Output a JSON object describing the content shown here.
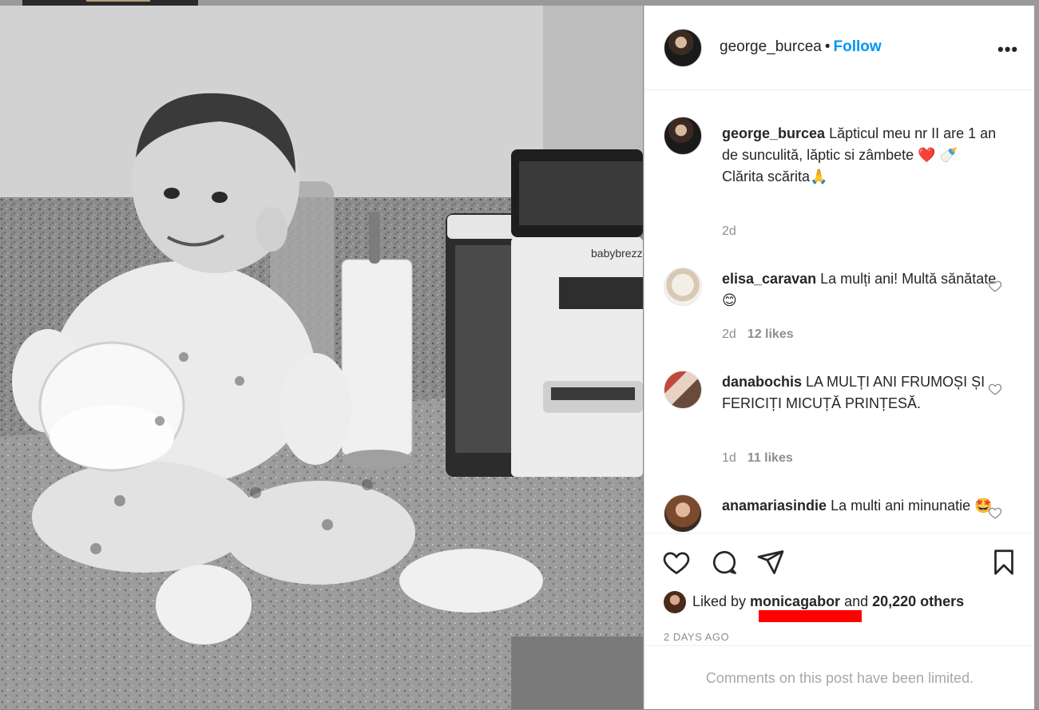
{
  "post": {
    "username": "george_burcea",
    "separator": "•",
    "follow_label": "Follow",
    "more_label": "•••"
  },
  "caption": {
    "username": "george_burcea",
    "line1": " Lăpticul meu nr II are 1 an de sunculită, lăptic si zâmbete ❤️ 🍼",
    "line2": "Clărita scărita🙏",
    "time": "2d"
  },
  "comments": [
    {
      "username": "elisa_caravan",
      "text": " La mulți ani! Multă sănătate😊",
      "time": "2d",
      "likes": "12 likes"
    },
    {
      "username": "danabochis",
      "text": " LA MULȚI ANI FRUMOȘI ȘI FERICIȚI MICUȚĂ PRINȚESĂ.",
      "time": "1d",
      "likes": "11 likes"
    },
    {
      "username": "anamariasindie",
      "text": " La multi ani minunatie 🤩",
      "time": "",
      "likes": ""
    }
  ],
  "likes": {
    "prefix": "Liked by ",
    "user": "monicagabor",
    "middle": " and ",
    "others": "20,220 others"
  },
  "timestamp": "2 DAYS AGO",
  "limited_notice": "Comments on this post have been limited.",
  "photo": {
    "brand_text": "babybrezza"
  },
  "colors": {
    "accent": "#0095f6",
    "redaction": "#ff0000"
  }
}
